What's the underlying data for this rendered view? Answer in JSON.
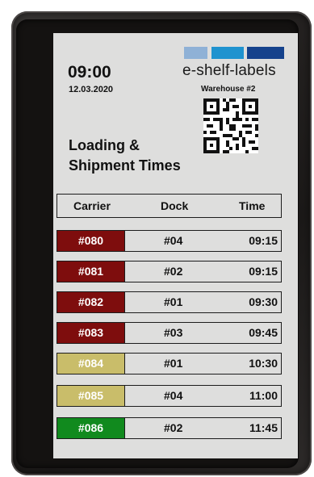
{
  "display": {
    "time": "09:00",
    "date": "12.03.2020",
    "brand": "e-shelf-labels",
    "brand_colors": [
      "#8fb1d6",
      "#1f93cf",
      "#15428c"
    ],
    "warehouse": "Warehouse #2",
    "qr_icon": "qr-code-icon",
    "heading_line1": "Loading &",
    "heading_line2": "Shipment Times"
  },
  "table": {
    "columns": [
      "Carrier",
      "Dock",
      "Time"
    ],
    "rows": [
      {
        "carrier": "#080",
        "dock": "#04",
        "time": "09:15",
        "status_color": "#7e0d0d"
      },
      {
        "carrier": "#081",
        "dock": "#02",
        "time": "09:15",
        "status_color": "#7e0d0d"
      },
      {
        "carrier": "#082",
        "dock": "#01",
        "time": "09:30",
        "status_color": "#7e0d0d"
      },
      {
        "carrier": "#083",
        "dock": "#03",
        "time": "09:45",
        "status_color": "#7e0d0d"
      },
      {
        "carrier": "#084",
        "dock": "#01",
        "time": "10:30",
        "status_color": "#c9bd6a"
      },
      {
        "carrier": "#085",
        "dock": "#04",
        "time": "11:00",
        "status_color": "#c9bd6a"
      },
      {
        "carrier": "#086",
        "dock": "#02",
        "time": "11:45",
        "status_color": "#118a1e"
      }
    ]
  }
}
